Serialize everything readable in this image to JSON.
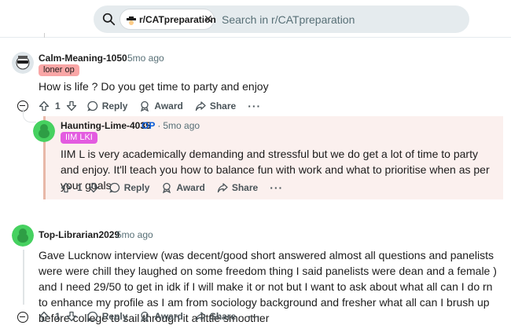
{
  "header": {
    "subreddit_chip": "r/CATpreparation",
    "search_placeholder": "Search in r/CATpreparation"
  },
  "comments": [
    {
      "author": "Calm-Meaning-1050",
      "time": "5mo ago",
      "flair": "loner op",
      "body": "How is life ? Do you get time to party and enjoy",
      "votes": "1",
      "actions": {
        "reply": "Reply",
        "award": "Award",
        "share": "Share"
      }
    },
    {
      "author": "Haunting-Lime-4035",
      "op_badge": "OP",
      "time": "5mo ago",
      "flair": "IIM LKI",
      "body": "IIM L is very academically demanding and stressful but we do get a lot of time to party and enjoy. It'll teach you how to balance fun with work and what to prioritise when as per your goals",
      "votes": "1",
      "actions": {
        "reply": "Reply",
        "award": "Award",
        "share": "Share"
      }
    },
    {
      "author": "Top-Librarian2029",
      "time": "5mo ago",
      "body": "Gave Lucknow interview (was decent/good short answered almost all questions and panelists were were chill they laughed on some freedom thing I said panelists were dean and a female ) and I need 29/50 to get in idk if I will make it or not but I want to ask about what all can I do rn to enhance my profile as I am from sociology background and fresher what all can I brush up before college to sail through it a little smoother",
      "votes": "1",
      "actions": {
        "reply": "Reply",
        "award": "Award",
        "share": "Share"
      }
    }
  ],
  "icons": [
    "search-icon",
    "close-icon",
    "upvote-icon",
    "downvote-icon",
    "reply-icon",
    "award-icon",
    "share-icon",
    "more-icon",
    "collapse-icon"
  ],
  "colors": {
    "op": "#0a5bd6",
    "flair_loner": "#f9a6a6",
    "flair_iim": "#e35be0",
    "reply_bg": "#fbf0ee"
  }
}
